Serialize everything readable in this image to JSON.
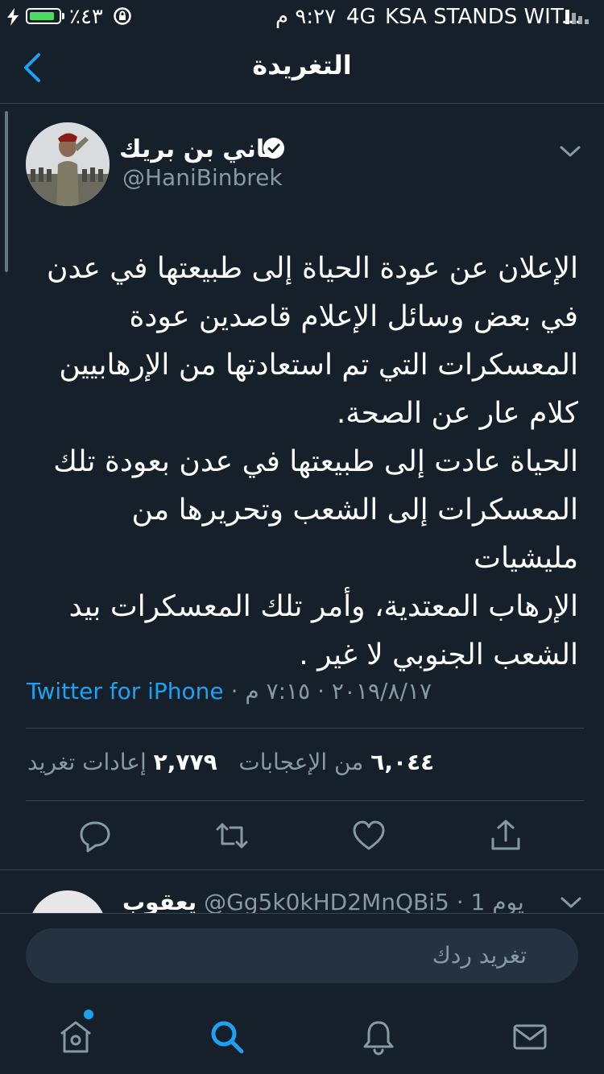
{
  "status_bar": {
    "battery_percent": "٪٤٣",
    "time": "٩:٢٧ م",
    "network": "4G",
    "carrier": "KSA STANDS WIT..."
  },
  "header": {
    "title": "التغريدة"
  },
  "tweet": {
    "author_name": "هاني بن بريك",
    "author_handle": "@HaniBinbrek",
    "text": "الإعلان عن عودة الحياة إلى طبيعتها في عدن\nفي بعض وسائل الإعلام قاصدين عودة\nالمعسكرات التي تم استعادتها من الإرهابيين\nكلام عار عن الصحة.\nالحياة عادت إلى طبيعتها في عدن بعودة تلك\nالمعسكرات إلى الشعب وتحريرها من مليشيات\nالإرهاب المعتدية، وأمر تلك المعسكرات بيد\nالشعب الجنوبي لا غير .",
    "source": "Twitter for iPhone",
    "meta": " · ٢٠١٩/٨/١٧ · ٧:١٥ م",
    "likes_count": "٦,٠٤٤",
    "likes_label": "من الإعجابات",
    "retweets_count": "٢,٧٧٩",
    "retweets_label": "إعادات تغريد"
  },
  "actions": [
    "reply-icon",
    "retweet-icon",
    "like-icon",
    "share-icon"
  ],
  "reply_preview": {
    "name": "يعقوب",
    "handle": "@Gg5k0kHD2MnQBi5",
    "time": " · 1 يوم"
  },
  "compose": {
    "placeholder": "تغريد ردك"
  },
  "tabs": [
    "home-icon",
    "search-icon",
    "notifications-icon",
    "messages-icon"
  ],
  "colors": {
    "background": "#15202b",
    "accent": "#1da1f2",
    "secondary_text": "#8899a6",
    "divider": "#38444d"
  }
}
